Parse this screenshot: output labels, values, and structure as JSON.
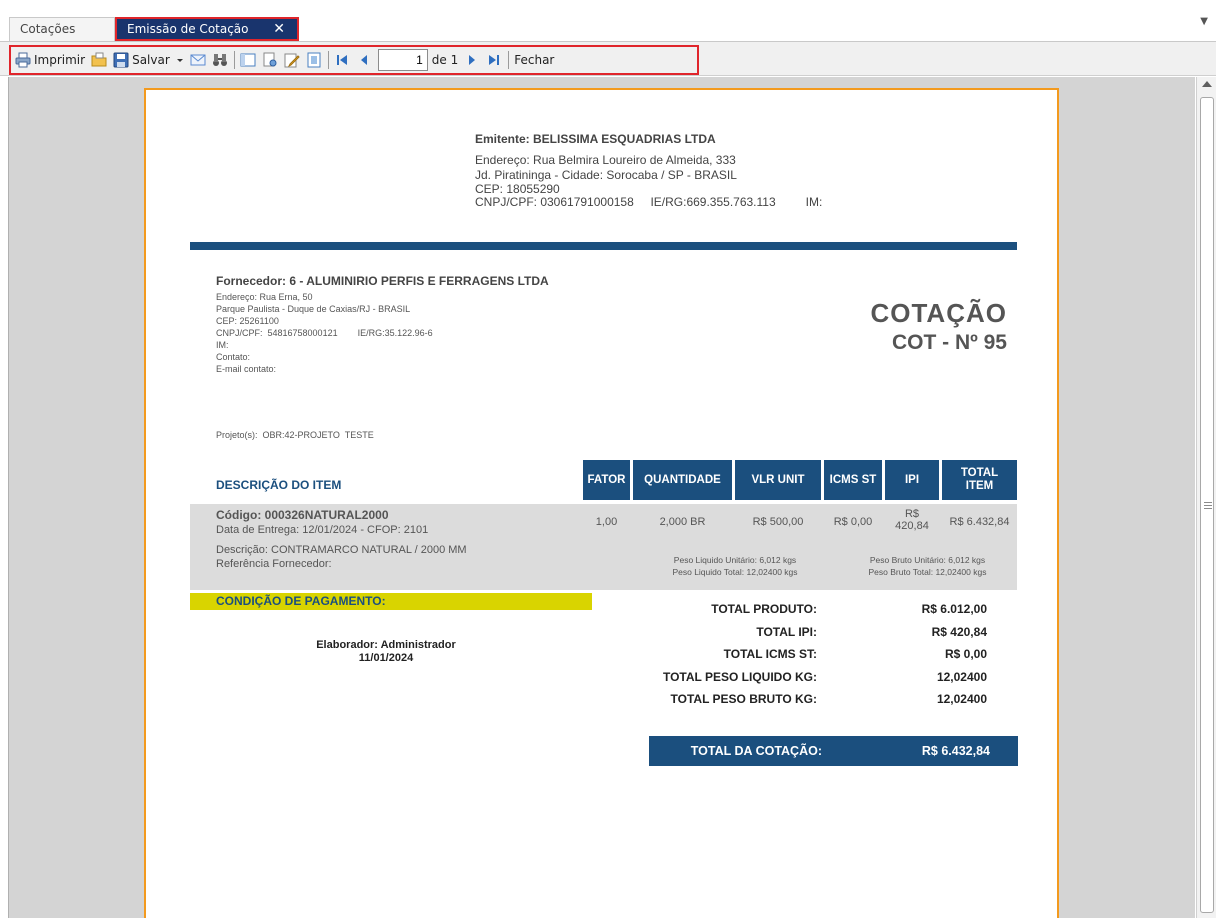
{
  "tabs": {
    "inactive_label": "Cotações",
    "active_label": "Emissão de Cotação",
    "close_glyph": "✕",
    "dropdown_glyph": "▼"
  },
  "toolbar": {
    "print_label": "Imprimir",
    "save_label": "Salvar",
    "page_value": "1",
    "page_of": "de 1",
    "close_label": "Fechar"
  },
  "document": {
    "emitente": {
      "title": "Emitente: BELISSIMA ESQUADRIAS LTDA",
      "endereco": "Endereço: Rua Belmira Loureiro de Almeida, 333",
      "bairro": "Jd. Piratininga - Cidade: Sorocaba / SP - BRASIL",
      "cep": "CEP: 18055290",
      "docs": "CNPJ/CPF: 03061791000158     IE/RG:669.355.763.113         IM:"
    },
    "fornecedor": {
      "title": "Fornecedor: 6 - ALUMINIRIO PERFIS E FERRAGENS LTDA",
      "endereco": "Endereço: Rua Erna, 50",
      "bairro": "Parque Paulista - Duque de Caxias/RJ - BRASIL",
      "cep": "CEP: 25261100",
      "docs": "CNPJ/CPF:  54816758000121        IE/RG:35.122.96-6",
      "im": "IM:",
      "contato": "Contato:",
      "email": "E-mail contato:"
    },
    "projeto": "Projeto(s):  OBR:42-PROJETO  TESTE",
    "cotacao_title": "COTAÇÃO",
    "cotacao_number": "COT - Nº 95",
    "table_headers": {
      "descricao": "DESCRIÇÃO DO ITEM",
      "fator": "FATOR",
      "quantidade": "QUANTIDADE",
      "vlr_unit": "VLR UNIT",
      "icms_st": "ICMS ST",
      "ipi": "IPI",
      "total_item_1": "TOTAL",
      "total_item_2": "ITEM"
    },
    "item": {
      "codigo": "Código: 000326NATURAL2000",
      "entrega": "Data de Entrega: 12/01/2024 - CFOP: 2101",
      "descricao": "Descrição: CONTRAMARCO NATURAL / 2000 MM",
      "referencia": "Referência Fornecedor:",
      "fator": "1,00",
      "quantidade": "2,000 BR",
      "vlr_unit": "R$ 500,00",
      "icms_st": "R$ 0,00",
      "ipi_1": "R$",
      "ipi_2": "420,84",
      "total": "R$ 6.432,84",
      "peso_liq_unit": "Peso Liquido Unitário: 6,012 kgs",
      "peso_liq_total": "Peso Liquido Total: 12,02400 kgs",
      "peso_bruto_unit": "Peso Bruto Unitário: 6,012 kgs",
      "peso_bruto_total": "Peso Bruto Total: 12,02400 kgs"
    },
    "condicao_pagamento": "CONDIÇÃO DE PAGAMENTO:",
    "elaborador": "Elaborador: Administrador",
    "elaborador_data": "11/01/2024",
    "totals": [
      {
        "label": "TOTAL PRODUTO:",
        "value": "R$ 6.012,00"
      },
      {
        "label": "TOTAL IPI:",
        "value": "R$ 420,84"
      },
      {
        "label": "TOTAL ICMS ST:",
        "value": "R$ 0,00"
      },
      {
        "label": "TOTAL PESO LIQUIDO KG:",
        "value": "12,02400"
      },
      {
        "label": "TOTAL PESO BRUTO KG:",
        "value": "12,02400"
      }
    ],
    "grand_total_label": "TOTAL DA COTAÇÃO:",
    "grand_total_value": "R$ 6.432,84"
  },
  "colors": {
    "tab_active_bg": "#19346d",
    "highlight_border": "#e0252b",
    "header_blue": "#1b4f7e",
    "page_border": "#f39a1e",
    "payment_yellow": "#d9d400"
  }
}
